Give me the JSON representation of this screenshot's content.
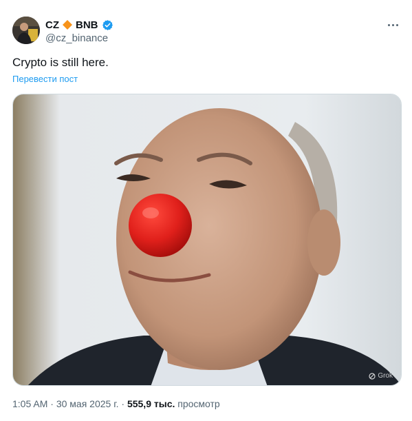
{
  "author": {
    "name_start": "CZ",
    "name_end": "BNB",
    "name_icon": "orange-diamond-icon",
    "verified_icon": "verified-badge-icon",
    "handle": "@cz_binance"
  },
  "tweet": {
    "text": "Crypto is still here.",
    "translate_link": "Перевести пост",
    "image_watermark": "Grok",
    "more_icon": "more-options-icon"
  },
  "meta": {
    "time": "1:05 AM",
    "separator": "·",
    "date": "30 мая 2025 г.",
    "views_count": "555,9 тыс.",
    "views_label": "просмотр"
  },
  "colors": {
    "link": "#1d9bf0",
    "verified": "#1d9bf0",
    "diamond": "#f7931a",
    "muted": "#536471",
    "text": "#0f1419",
    "clown_nose": "#e0201b"
  }
}
